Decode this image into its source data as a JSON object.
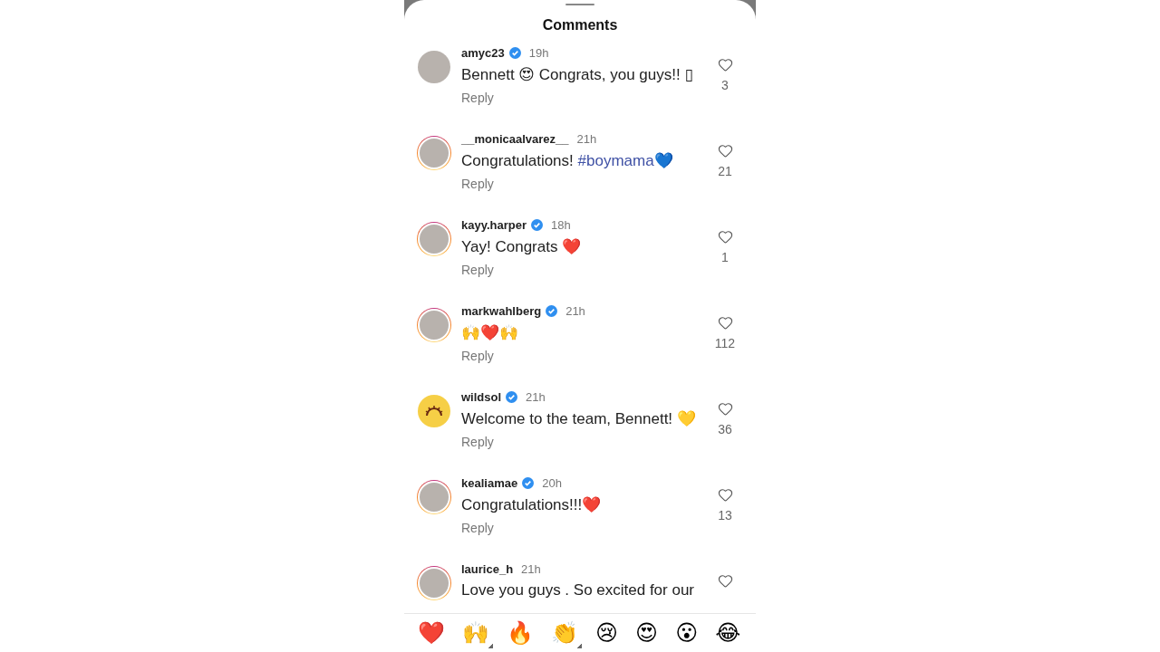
{
  "sheet": {
    "title": "Comments"
  },
  "comments": [
    {
      "username": "amyc23",
      "verified": true,
      "story_ring": false,
      "kind": "photo",
      "time": "19h",
      "parts": [
        {
          "kind": "plain",
          "text": "Bennett 😍 Congrats, you guys!! ▯"
        }
      ],
      "reply": "Reply",
      "likes": "3"
    },
    {
      "username": "__monicaalvarez__",
      "verified": false,
      "story_ring": true,
      "kind": "photo",
      "time": "21h",
      "parts": [
        {
          "kind": "plain",
          "text": "Congratulations! "
        },
        {
          "kind": "hashtag",
          "text": "#boymama"
        },
        {
          "kind": "plain",
          "text": "💙"
        }
      ],
      "reply": "Reply",
      "likes": "21"
    },
    {
      "username": "kayy.harper",
      "verified": true,
      "story_ring": true,
      "kind": "photo",
      "time": "18h",
      "parts": [
        {
          "kind": "plain",
          "text": "Yay! Congrats ❤️"
        }
      ],
      "reply": "Reply",
      "likes": "1"
    },
    {
      "username": "markwahlberg",
      "verified": true,
      "story_ring": true,
      "kind": "photo",
      "time": "21h",
      "parts": [
        {
          "kind": "plain",
          "text": "🙌❤️🙌"
        }
      ],
      "reply": "Reply",
      "likes": "112"
    },
    {
      "username": "wildsol",
      "verified": true,
      "story_ring": false,
      "kind": "logo",
      "time": "21h",
      "parts": [
        {
          "kind": "plain",
          "text": "Welcome to the team, Bennett! 💛"
        }
      ],
      "reply": "Reply",
      "likes": "36"
    },
    {
      "username": "kealiamae",
      "verified": true,
      "story_ring": true,
      "kind": "photo",
      "time": "20h",
      "parts": [
        {
          "kind": "plain",
          "text": "Congratulations!!!❤️"
        }
      ],
      "reply": "Reply",
      "likes": "13"
    },
    {
      "username": "laurice_h",
      "verified": false,
      "story_ring": true,
      "kind": "photo",
      "time": "21h",
      "parts": [
        {
          "kind": "plain",
          "text": "Love you guys . So excited for our"
        }
      ]
    }
  ],
  "reactions": [
    {
      "emoji": "❤️",
      "skin_tone": false
    },
    {
      "emoji": "🙌",
      "skin_tone": true
    },
    {
      "emoji": "🔥",
      "skin_tone": false
    },
    {
      "emoji": "👏",
      "skin_tone": true
    },
    {
      "emoji": "😢",
      "skin_tone": false
    },
    {
      "emoji": "😍",
      "skin_tone": false
    },
    {
      "emoji": "😮",
      "skin_tone": false
    },
    {
      "emoji": "😂",
      "skin_tone": false
    }
  ]
}
